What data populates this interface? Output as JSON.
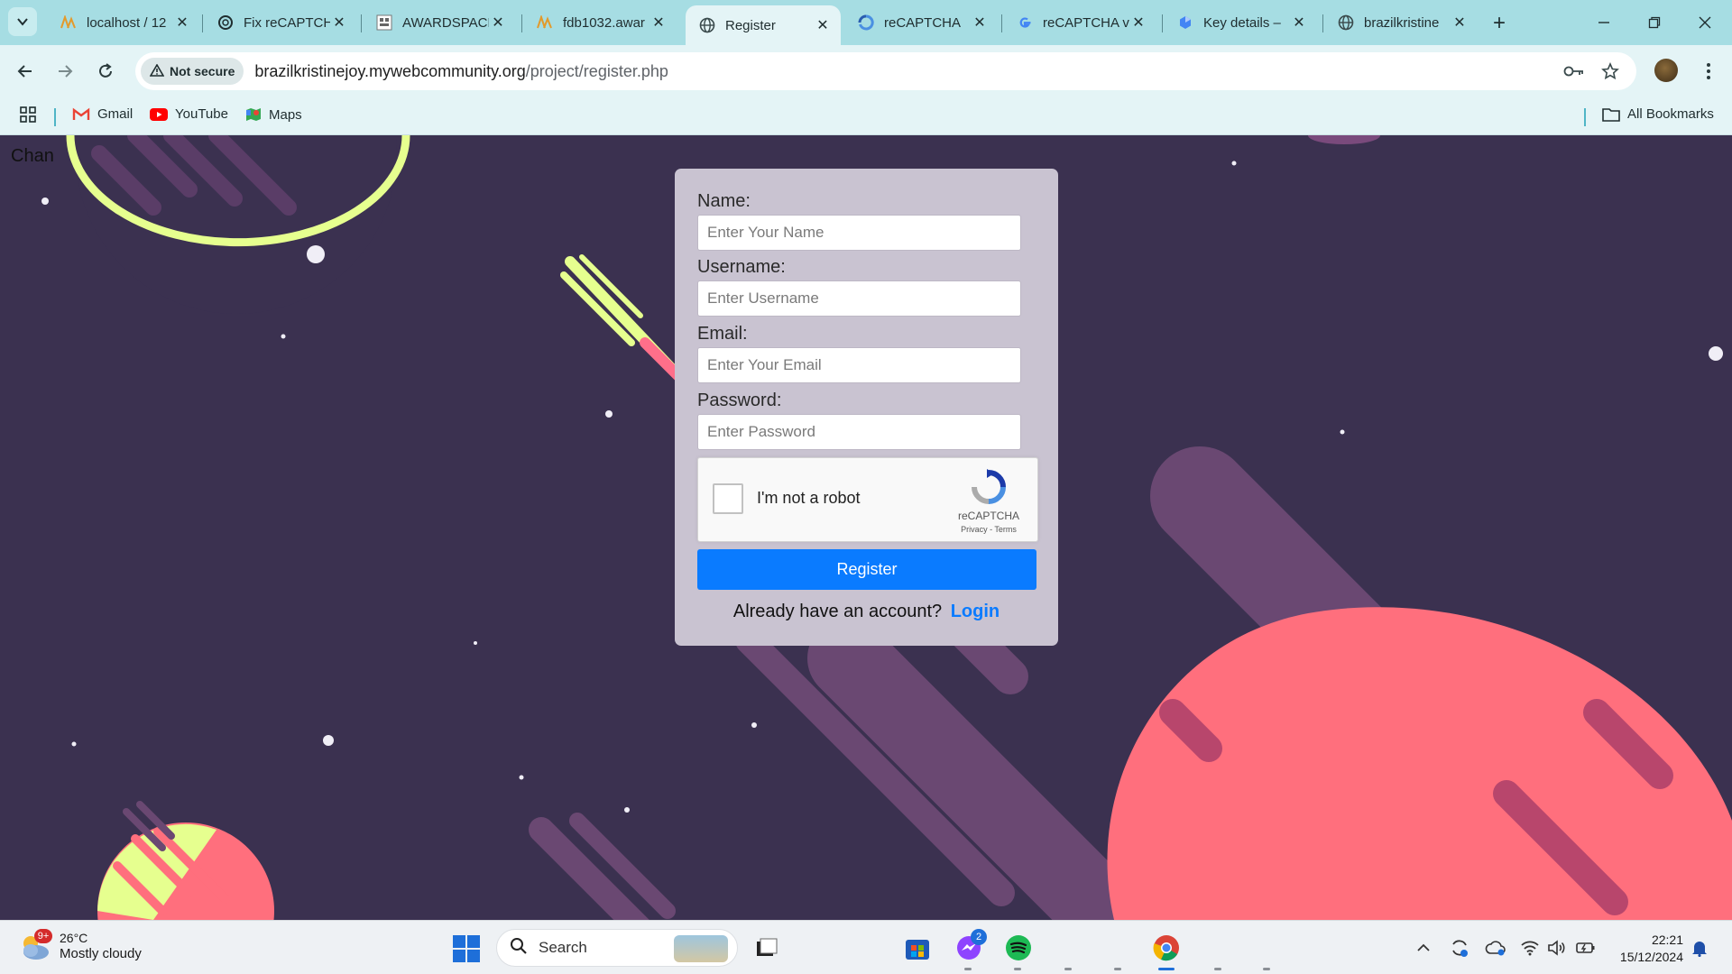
{
  "browser": {
    "tabs": [
      {
        "title": "localhost / 12",
        "favicon": "phpmyadmin-icon",
        "active": false
      },
      {
        "title": "Fix reCAPTCHA",
        "favicon": "chatgpt-icon",
        "active": false
      },
      {
        "title": "AWARDSPACE",
        "favicon": "awardspace-icon",
        "active": false
      },
      {
        "title": "fdb1032.awar",
        "favicon": "phpmyadmin-icon",
        "active": false
      },
      {
        "title": "Register",
        "favicon": "globe-icon",
        "active": true
      },
      {
        "title": "reCAPTCHA",
        "favicon": "recaptcha-icon",
        "active": false
      },
      {
        "title": "reCAPTCHA v",
        "favicon": "google-icon",
        "active": false
      },
      {
        "title": "Key details –",
        "favicon": "cloud-icon",
        "active": false
      },
      {
        "title": "brazilkristine",
        "favicon": "globe-icon",
        "active": false
      }
    ],
    "security_label": "Not secure",
    "url_host": "brazilkristinejoy.mywebcommunity.org",
    "url_path": "/project/register.php",
    "bookmarks": [
      {
        "label": "Gmail",
        "icon": "gmail-icon"
      },
      {
        "label": "YouTube",
        "icon": "youtube-icon"
      },
      {
        "label": "Maps",
        "icon": "maps-icon"
      }
    ],
    "all_bookmarks_label": "All Bookmarks"
  },
  "page": {
    "corner_text": "Chan",
    "form": {
      "name_label": "Name:",
      "name_placeholder": "Enter Your Name",
      "username_label": "Username:",
      "username_placeholder": "Enter Username",
      "email_label": "Email:",
      "email_placeholder": "Enter Your Email",
      "password_label": "Password:",
      "password_placeholder": "Enter Password",
      "captcha_label": "I'm not a robot",
      "captcha_brand": "reCAPTCHA",
      "captcha_links": "Privacy - Terms",
      "register_button": "Register",
      "already_text": "Already have an account?",
      "login_link": "Login"
    }
  },
  "taskbar": {
    "weather_badge": "9+",
    "temperature": "26°C",
    "condition": "Mostly cloudy",
    "search_label": "Search",
    "messenger_badge": "2",
    "time": "22:21",
    "date": "15/12/2024"
  },
  "colors": {
    "background": "#3b3150",
    "accent_blue": "#0a7bff",
    "planet_coral": "#ff6f7d",
    "ring_lime": "#e6ff8f"
  }
}
